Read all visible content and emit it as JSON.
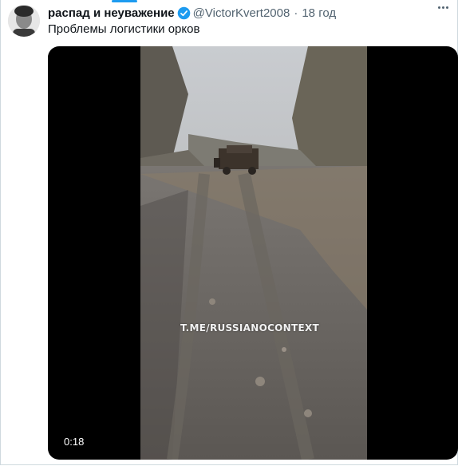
{
  "tweet": {
    "author_name": "распад и неуважение",
    "verified_icon": "verified-badge-icon",
    "handle": "@VictorKvert2008",
    "separator": "·",
    "time": "18 год",
    "text": "Проблемы логистики орков"
  },
  "media": {
    "watermark": "T.ME/RUSSIANOCONTEXT",
    "duration": "0:18"
  },
  "colors": {
    "accent": "#1d9bf0",
    "secondary_text": "#536471",
    "primary_text": "#0f1419"
  }
}
